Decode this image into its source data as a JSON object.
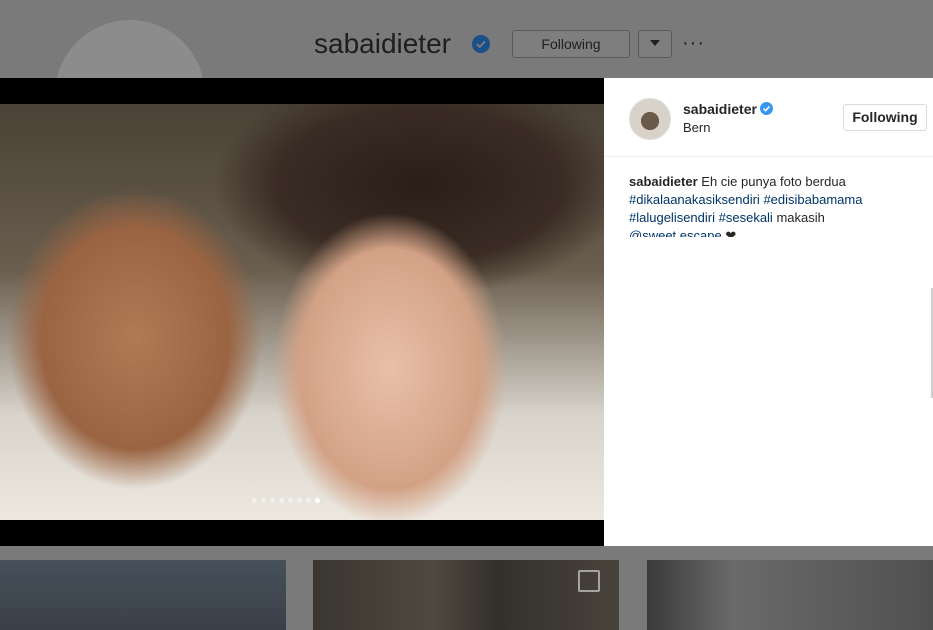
{
  "profile": {
    "username": "sabaidieter",
    "follow_button": "Following",
    "more": "···"
  },
  "post": {
    "username": "sabaidieter",
    "location": "Bern",
    "follow_button": "Following",
    "caption_text": "Eh cie punya foto berdua",
    "hashtags": [
      "#dikalaanakasiksendiri",
      "#edisibabamama",
      "#lalugelisendiri",
      "#sesekali"
    ],
    "caption_tail": "makasih",
    "mention": "@sweet.escape",
    "carousel_count": 8,
    "carousel_active_index": 7,
    "colors": {
      "verified": "#3897f0",
      "link": "#003569"
    }
  }
}
